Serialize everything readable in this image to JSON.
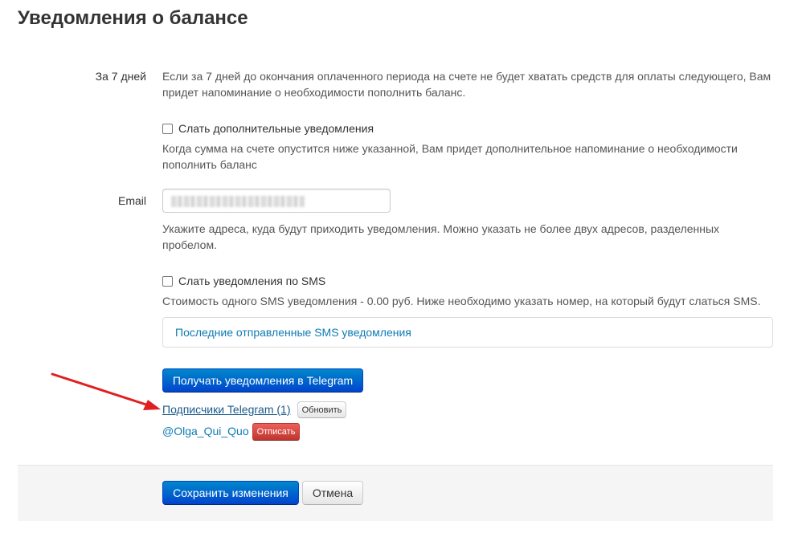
{
  "page": {
    "title": "Уведомления о балансе"
  },
  "period": {
    "label": "За 7 дней",
    "help": "Если за 7 дней до окончания оплаченного периода на счете не будет хватать средств для оплаты следующего, Вам придет напоминание о необходимости пополнить баланс."
  },
  "extra_notifications": {
    "checkbox_label": "Слать дополнительные уведомления",
    "checked": false,
    "help": "Когда сумма на счете опустится ниже указанной, Вам придет дополнительное напоминание о необходимости пополнить баланс"
  },
  "email": {
    "label": "Email",
    "help": "Укажите адреса, куда будут приходить уведомления. Можно указать не более двух адресов, разделенных пробелом."
  },
  "sms": {
    "checkbox_label": "Слать уведомления по SMS",
    "checked": false,
    "help": "Стоимость одного SMS уведомления - 0.00 руб. Ниже необходимо указать номер, на который будут слаться SMS.",
    "history_link": "Последние отправленные SMS уведомления"
  },
  "telegram": {
    "get_button": "Получать уведомления в Telegram",
    "subscribers_link": "Подписчики Telegram (1)",
    "refresh_button": "Обновить",
    "subscriber": "@Olga_Qui_Quo",
    "unsubscribe_button": "Отписать"
  },
  "actions": {
    "save_button": "Сохранить изменения",
    "cancel_button": "Отмена"
  },
  "colors": {
    "primary": "#0066cc",
    "danger": "#d9534f",
    "link": "#0e7bb5",
    "annotation_arrow": "#e02020"
  }
}
